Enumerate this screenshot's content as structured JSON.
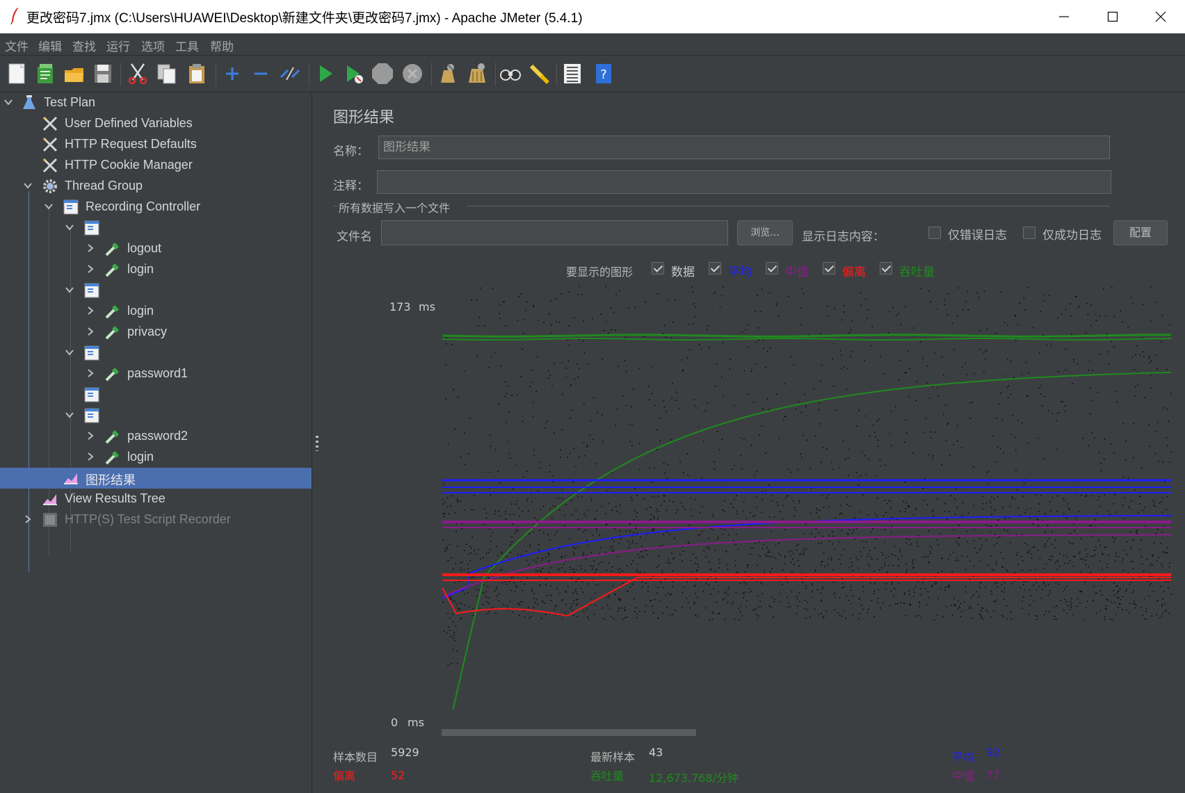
{
  "window": {
    "title": "更改密码7.jmx (C:\\Users\\HUAWEI\\Desktop\\新建文件夹\\更改密码7.jmx) - Apache JMeter (5.4.1)"
  },
  "menu": [
    "文件",
    "编辑",
    "查找",
    "运行",
    "选项",
    "工具",
    "帮助"
  ],
  "toolbar": [
    "new-icon",
    "templates-icon",
    "open-icon",
    "save-icon",
    "cut-icon",
    "copy-icon",
    "paste-icon",
    "expand-icon",
    "collapse-icon",
    "toggle-icon",
    "start-icon",
    "start-no-timers-icon",
    "stop-icon",
    "shutdown-icon",
    "clear-icon",
    "clear-all-icon",
    "search-icon",
    "reset-search-icon",
    "function-helper-icon",
    "help-icon"
  ],
  "tree": {
    "items": [
      {
        "label": "Test Plan"
      },
      {
        "label": "User Defined Variables"
      },
      {
        "label": "HTTP Request Defaults"
      },
      {
        "label": "HTTP Cookie Manager"
      },
      {
        "label": "Thread Group"
      },
      {
        "label": "Recording Controller"
      },
      {
        "label": ""
      },
      {
        "label": "logout"
      },
      {
        "label": "login"
      },
      {
        "label": ""
      },
      {
        "label": "login"
      },
      {
        "label": "privacy"
      },
      {
        "label": ""
      },
      {
        "label": "password1"
      },
      {
        "label": ""
      },
      {
        "label": ""
      },
      {
        "label": "password2"
      },
      {
        "label": "login"
      },
      {
        "label": "图形结果"
      },
      {
        "label": "View Results Tree"
      },
      {
        "label": "HTTP(S) Test Script Recorder"
      }
    ]
  },
  "panel": {
    "title": "图形结果",
    "name_label": "名称：",
    "name_value": "图形结果",
    "comment_label": "注释：",
    "comment_value": "",
    "file_section": "所有数据写入一个文件",
    "filename_label": "文件名",
    "filename_value": "",
    "browse_button": "浏览...",
    "log_display_label": "显示日志内容：",
    "errors_only_label": "仅错误日志",
    "success_only_label": "仅成功日志",
    "configure_button": "配置"
  },
  "graph_options": {
    "label": "要显示的图形",
    "items": [
      {
        "label": "数据",
        "checked": true,
        "color": "#c8c8c8"
      },
      {
        "label": "平均",
        "checked": true,
        "color": "#1d1dff"
      },
      {
        "label": "中值",
        "checked": true,
        "color": "#8a1c8a"
      },
      {
        "label": "偏离",
        "checked": true,
        "color": "#ff1a1a"
      },
      {
        "label": "吞吐量",
        "checked": true,
        "color": "#1f8a1f"
      }
    ]
  },
  "graph": {
    "y_max": "173",
    "y_min": "0",
    "unit": "ms"
  },
  "stats": {
    "samples_label": "样本数目",
    "samples_value": "5929",
    "latest_label": "最新样本",
    "latest_value": "43",
    "average_label": "平均",
    "average_value": "92",
    "deviation_label": "偏离",
    "deviation_value": "52",
    "throughput_label": "吞吐量",
    "throughput_value": "12,673.768/分钟",
    "median_label": "中值",
    "median_value": "77"
  },
  "colors": {
    "background": "#3c3f41",
    "selection": "#4b6eaf",
    "average": "#1d1dff",
    "median": "#8a1c8a",
    "deviation": "#ff1a1a",
    "throughput": "#1f8a1f"
  }
}
